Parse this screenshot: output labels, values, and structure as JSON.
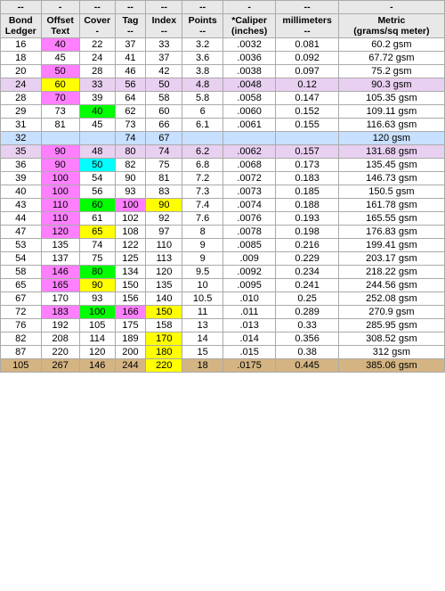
{
  "headers": {
    "row1": [
      "--",
      "-",
      "--",
      "--",
      "--",
      "--",
      "-",
      "--",
      "-"
    ],
    "row2": [
      "Bond\nLedger",
      "Offset\nText",
      "Cover\n-",
      "Tag\n--",
      "Index\n--",
      "Points\n--",
      "*Caliper\n(inches)",
      "millimeters\n--",
      "Metric\n(grams/sq meter)"
    ]
  },
  "rows": [
    {
      "bond": "16",
      "offset": "40",
      "cover": "22",
      "tag": "37",
      "index": "33",
      "points": "3.2",
      "caliper": ".0032",
      "mm": "0.081",
      "metric": "60.2 gsm",
      "off_cls": "bg-pink"
    },
    {
      "bond": "18",
      "offset": "45",
      "cover": "24",
      "tag": "41",
      "index": "37",
      "points": "3.6",
      "caliper": ".0036",
      "mm": "0.092",
      "metric": "67.72 gsm",
      "off_cls": ""
    },
    {
      "bond": "20",
      "offset": "50",
      "cover": "28",
      "tag": "46",
      "index": "42",
      "points": "3.8",
      "caliper": ".0038",
      "mm": "0.097",
      "metric": "75.2 gsm",
      "off_cls": "bg-pink"
    },
    {
      "bond": "24",
      "offset": "60",
      "cover": "33",
      "tag": "56",
      "index": "50",
      "points": "4.8",
      "caliper": ".0048",
      "mm": "0.12",
      "metric": "90.3 gsm",
      "off_cls": "bg-yellow",
      "row_cls": "bg-lavender"
    },
    {
      "bond": "28",
      "offset": "70",
      "cover": "39",
      "tag": "64",
      "index": "58",
      "points": "5.8",
      "caliper": ".0058",
      "mm": "0.147",
      "metric": "105.35 gsm",
      "off_cls": "bg-pink"
    },
    {
      "bond": "29",
      "offset": "73",
      "cover": "40",
      "tag": "62",
      "index": "60",
      "points": "6",
      "caliper": ".0060",
      "mm": "0.152",
      "metric": "109.11 gsm",
      "off_cls": "",
      "cov_cls": "bg-green"
    },
    {
      "bond": "31",
      "offset": "81",
      "cover": "45",
      "tag": "73",
      "index": "66",
      "points": "6.1",
      "caliper": ".0061",
      "mm": "0.155",
      "metric": "116.63 gsm",
      "off_cls": ""
    },
    {
      "bond": "32",
      "offset": "",
      "cover": "",
      "tag": "74",
      "index": "67",
      "points": "",
      "caliper": "",
      "mm": "",
      "metric": "120 gsm",
      "off_cls": "",
      "row_cls": "bg-lt-blue"
    },
    {
      "bond": "35",
      "offset": "90",
      "cover": "48",
      "tag": "80",
      "index": "74",
      "points": "6.2",
      "caliper": ".0062",
      "mm": "0.157",
      "metric": "131.68 gsm",
      "off_cls": "bg-pink",
      "row_cls": "bg-lavender"
    },
    {
      "bond": "36",
      "offset": "90",
      "cover": "50",
      "tag": "82",
      "index": "75",
      "points": "6.8",
      "caliper": ".0068",
      "mm": "0.173",
      "metric": "135.45 gsm",
      "off_cls": "bg-pink",
      "cov_cls": "bg-cyan"
    },
    {
      "bond": "39",
      "offset": "100",
      "cover": "54",
      "tag": "90",
      "index": "81",
      "points": "7.2",
      "caliper": ".0072",
      "mm": "0.183",
      "metric": "146.73 gsm",
      "off_cls": "bg-pink"
    },
    {
      "bond": "40",
      "offset": "100",
      "cover": "56",
      "tag": "93",
      "index": "83",
      "points": "7.3",
      "caliper": ".0073",
      "mm": "0.185",
      "metric": "150.5 gsm",
      "off_cls": "bg-pink"
    },
    {
      "bond": "43",
      "offset": "110",
      "cover": "60",
      "tag": "100",
      "index": "90",
      "points": "7.4",
      "caliper": ".0074",
      "mm": "0.188",
      "metric": "161.78 gsm",
      "off_cls": "bg-pink",
      "cov_cls": "bg-green",
      "tag_cls": "bg-pink",
      "idx_cls": "bg-yellow"
    },
    {
      "bond": "44",
      "offset": "110",
      "cover": "61",
      "tag": "102",
      "index": "92",
      "points": "7.6",
      "caliper": ".0076",
      "mm": "0.193",
      "metric": "165.55 gsm",
      "off_cls": "bg-pink"
    },
    {
      "bond": "47",
      "offset": "120",
      "cover": "65",
      "tag": "108",
      "index": "97",
      "points": "8",
      "caliper": ".0078",
      "mm": "0.198",
      "metric": "176.83 gsm",
      "off_cls": "bg-pink",
      "cov_cls": "bg-yellow"
    },
    {
      "bond": "53",
      "offset": "135",
      "cover": "74",
      "tag": "122",
      "index": "110",
      "points": "9",
      "caliper": ".0085",
      "mm": "0.216",
      "metric": "199.41 gsm",
      "off_cls": ""
    },
    {
      "bond": "54",
      "offset": "137",
      "cover": "75",
      "tag": "125",
      "index": "113",
      "points": "9",
      "caliper": ".009",
      "mm": "0.229",
      "metric": "203.17 gsm",
      "off_cls": ""
    },
    {
      "bond": "58",
      "offset": "146",
      "cover": "80",
      "tag": "134",
      "index": "120",
      "points": "9.5",
      "caliper": ".0092",
      "mm": "0.234",
      "metric": "218.22 gsm",
      "off_cls": "bg-pink",
      "cov_cls": "bg-green"
    },
    {
      "bond": "65",
      "offset": "165",
      "cover": "90",
      "tag": "150",
      "index": "135",
      "points": "10",
      "caliper": ".0095",
      "mm": "0.241",
      "metric": "244.56 gsm",
      "off_cls": "bg-pink",
      "cov_cls": "bg-yellow"
    },
    {
      "bond": "67",
      "offset": "170",
      "cover": "93",
      "tag": "156",
      "index": "140",
      "points": "10.5",
      "caliper": ".010",
      "mm": "0.25",
      "metric": "252.08 gsm",
      "off_cls": ""
    },
    {
      "bond": "72",
      "offset": "183",
      "cover": "100",
      "tag": "166",
      "index": "150",
      "points": "11",
      "caliper": ".011",
      "mm": "0.289",
      "metric": "270.9 gsm",
      "off_cls": "bg-pink",
      "cov_cls": "bg-green",
      "tag_cls": "bg-pink",
      "idx_cls": "bg-yellow"
    },
    {
      "bond": "76",
      "offset": "192",
      "cover": "105",
      "tag": "175",
      "index": "158",
      "points": "13",
      "caliper": ".013",
      "mm": "0.33",
      "metric": "285.95 gsm",
      "off_cls": ""
    },
    {
      "bond": "82",
      "offset": "208",
      "cover": "114",
      "tag": "189",
      "index": "170",
      "points": "14",
      "caliper": ".014",
      "mm": "0.356",
      "metric": "308.52 gsm",
      "off_cls": "",
      "idx_cls": "bg-yellow"
    },
    {
      "bond": "87",
      "offset": "220",
      "cover": "120",
      "tag": "200",
      "index": "180",
      "points": "15",
      "caliper": ".015",
      "mm": "0.38",
      "metric": "312 gsm",
      "off_cls": "",
      "idx_cls": "bg-yellow"
    },
    {
      "bond": "105",
      "offset": "267",
      "cover": "146",
      "tag": "244",
      "index": "220",
      "points": "18",
      "caliper": ".0175",
      "mm": "0.445",
      "metric": "385.06 gsm",
      "off_cls": "",
      "idx_cls": "bg-yellow",
      "row_cls": "bg-tan"
    }
  ]
}
